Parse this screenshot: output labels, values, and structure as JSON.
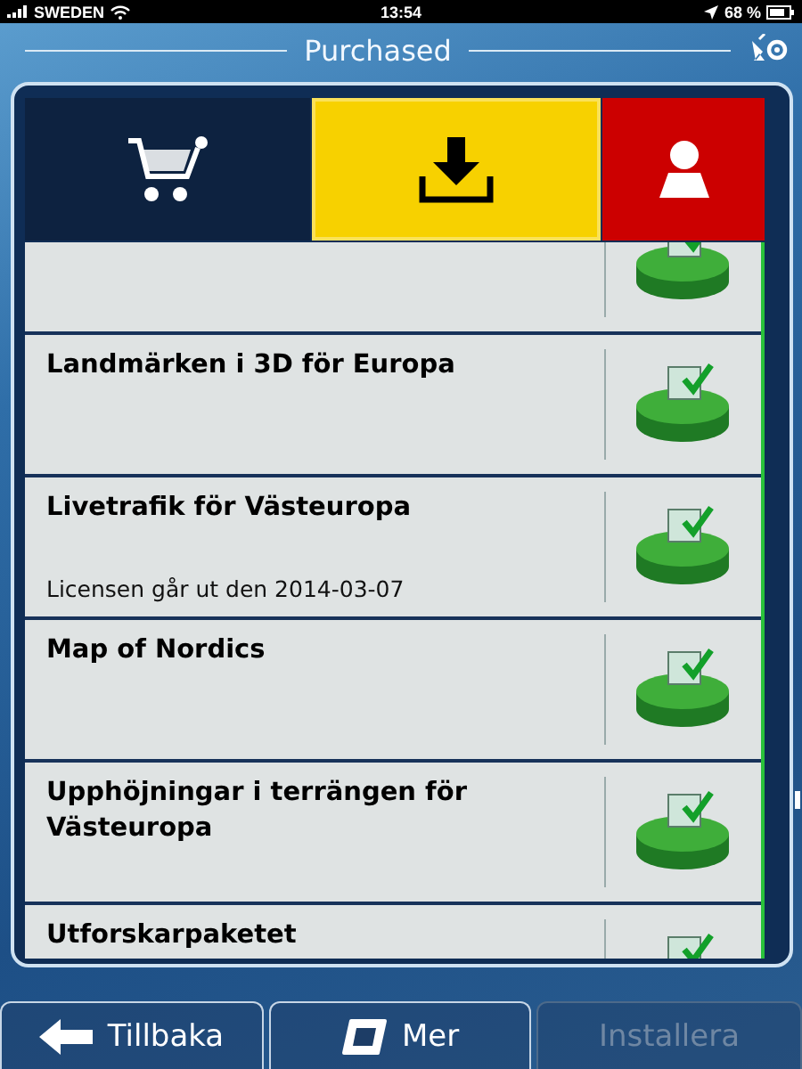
{
  "status_bar": {
    "carrier": "SWEDEN",
    "time": "13:54",
    "battery": "68 %"
  },
  "header": {
    "title": "Purchased"
  },
  "tabs": [
    {
      "kind": "store",
      "selected": false
    },
    {
      "kind": "downloads",
      "selected": true
    },
    {
      "kind": "account",
      "selected": false
    }
  ],
  "items": [
    {
      "installed": true
    },
    {
      "title": "Landmärken i 3D för Europa",
      "installed": true
    },
    {
      "title": "Livetrafik för Västeuropa",
      "note": "Licensen går ut den 2014-03-07",
      "installed": true
    },
    {
      "title": "Map of Nordics",
      "installed": true
    },
    {
      "title": "Upphöjningar i terrängen för Västeuropa",
      "installed": true
    },
    {
      "title": "Utforskarpaketet",
      "installed": true
    }
  ],
  "buttons": [
    {
      "kind": "back",
      "label": "Tillbaka",
      "disabled": false
    },
    {
      "kind": "more",
      "label": "Mer",
      "disabled": false
    },
    {
      "kind": "plain",
      "label": "Installera",
      "disabled": true
    }
  ]
}
